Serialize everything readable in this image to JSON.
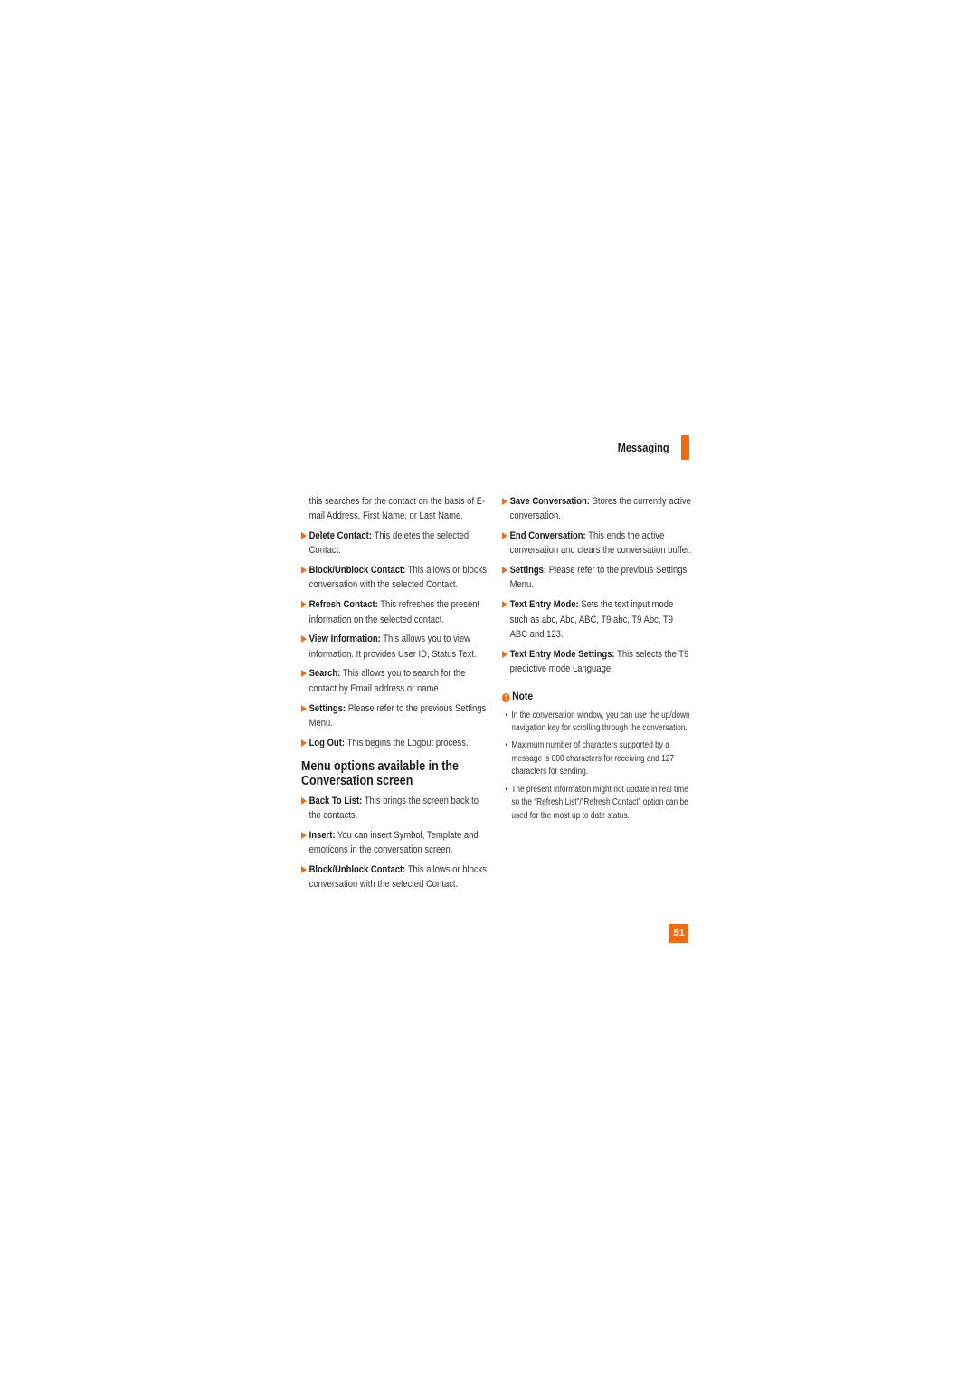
{
  "header": {
    "section_title": "Messaging",
    "accent_color": "#f26a12"
  },
  "left_column": {
    "intro_continuation": "this searches for the contact on the basis of E-mail Address, First Name, or Last Name.",
    "items": [
      {
        "term": "Delete Contact:",
        "desc": "This deletes the selected Contact."
      },
      {
        "term": "Block/Unblock Contact:",
        "desc": "This allows or blocks conversation with the selected Contact."
      },
      {
        "term": "Refresh Contact:",
        "desc": "This refreshes the present information on the selected contact."
      },
      {
        "term": "View Information:",
        "desc": "This allows you to view information. It provides User ID, Status Text."
      },
      {
        "term": "Search:",
        "desc": "This allows you to search for the contact by Email address or name."
      },
      {
        "term": "Settings:",
        "desc": "Please refer to the previous Settings Menu."
      },
      {
        "term": "Log Out:",
        "desc": "This begins the Logout process."
      }
    ],
    "section_heading": "Menu options available in the Conversation screen",
    "section_items": [
      {
        "term": "Back To List:",
        "desc": "This brings the screen back to the contacts."
      },
      {
        "term": "Insert:",
        "desc": "You can insert Symbol, Template and emoticons in the conversation screen."
      },
      {
        "term": "Block/Unblock Contact:",
        "desc": "This allows or blocks conversation with the selected Contact."
      }
    ]
  },
  "right_column": {
    "items": [
      {
        "term": "Save Conversation:",
        "desc": "Stores the currently active conversation."
      },
      {
        "term": "End Conversation:",
        "desc": "This ends the active conversation and clears the conversation buffer."
      },
      {
        "term": "Settings:",
        "desc": "Please refer to the previous Settings Menu."
      },
      {
        "term": "Text Entry Mode:",
        "desc": "Sets the text input mode such as abc, Abc, ABC, T9 abc, T9 Abc, T9 ABC and 123."
      },
      {
        "term": "Text Entry Mode Settings:",
        "desc": "This selects the T9 predictive mode Language."
      }
    ],
    "note": {
      "icon": "!",
      "title": "Note",
      "items": [
        "In the conversation window, you can use the up/down navigation key for scrolling through the conversation.",
        "Maximum number of characters supported by a message is 800 characters for receiving and 127 characters for sending.",
        "The present information might not update in real time so the “Refresh List”/“Refresh Contact” option can be used for the most up to date status."
      ]
    }
  },
  "footer": {
    "page_number": "51"
  }
}
